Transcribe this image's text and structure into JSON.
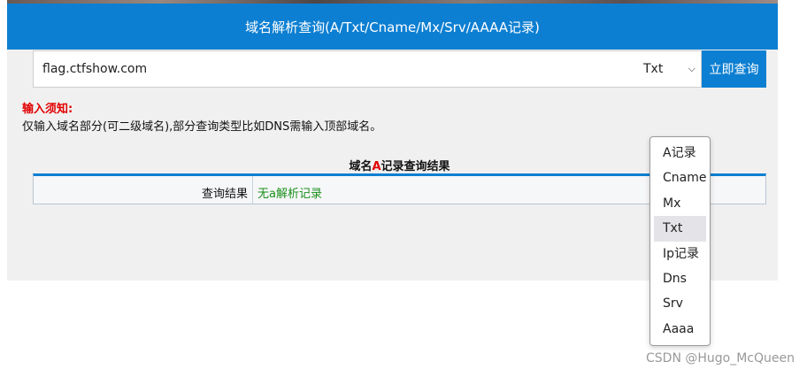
{
  "header": {
    "title": "域名解析查询(A/Txt/Cname/Mx/Srv/AAAA记录)"
  },
  "search": {
    "domain_value": "flag.ctfshow.com",
    "selected_type": "Txt",
    "submit_label": "立即查询"
  },
  "dropdown": {
    "options": [
      {
        "label": "A记录"
      },
      {
        "label": "Cname"
      },
      {
        "label": "Mx"
      },
      {
        "label": "Txt"
      },
      {
        "label": "Ip记录"
      },
      {
        "label": "Dns"
      },
      {
        "label": "Srv"
      },
      {
        "label": "Aaaa"
      }
    ],
    "highlighted": "Txt"
  },
  "notice": {
    "title": "输入须知:",
    "text": "仅输入域名部分(可二级域名),部分查询类型比如DNS需输入顶部域名。"
  },
  "result": {
    "title_prefix": "域名",
    "title_highlight": "A",
    "title_suffix": "记录查询结果",
    "label": "查询结果",
    "value": "无a解析记录"
  },
  "watermark": "CSDN @Hugo_McQueen",
  "colors": {
    "accent": "#0d7fd2",
    "notice": "#e20000",
    "result_ok": "#1a8f1a"
  }
}
